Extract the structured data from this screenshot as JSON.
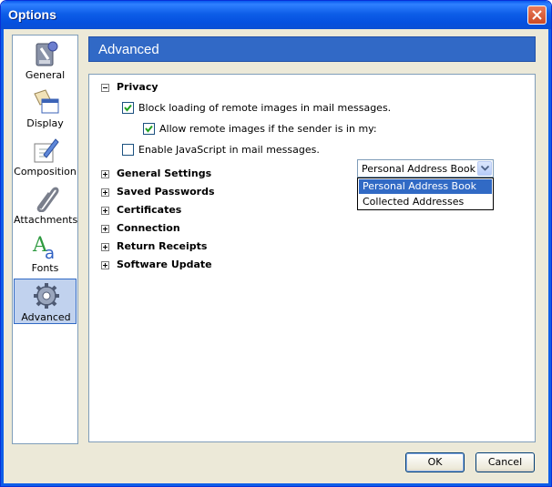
{
  "window": {
    "title": "Options"
  },
  "sidebar": {
    "items": [
      {
        "label": "General",
        "icon": "general-settings-icon"
      },
      {
        "label": "Display",
        "icon": "display-icon"
      },
      {
        "label": "Composition",
        "icon": "composition-pen-icon"
      },
      {
        "label": "Attachments",
        "icon": "paperclip-icon"
      },
      {
        "label": "Fonts",
        "icon": "fonts-icon"
      },
      {
        "label": "Advanced",
        "icon": "gear-icon",
        "selected": true
      }
    ]
  },
  "panel": {
    "header": "Advanced",
    "privacy": {
      "label": "Privacy",
      "block_remote_images": "Block loading of remote images in mail messages.",
      "allow_remote_images": "Allow remote images if the sender is in my:",
      "enable_javascript": "Enable JavaScript in mail messages.",
      "address_book_select": {
        "selected": "Personal Address Book",
        "options": [
          "Personal Address Book",
          "Collected Addresses"
        ]
      }
    },
    "sections": [
      "General Settings",
      "Saved Passwords",
      "Certificates",
      "Connection",
      "Return Receipts",
      "Software Update"
    ]
  },
  "buttons": {
    "ok": "OK",
    "cancel": "Cancel"
  },
  "colors": {
    "title_bar": "#0a5bee",
    "header": "#3169c6",
    "highlight": "#316ac5"
  }
}
